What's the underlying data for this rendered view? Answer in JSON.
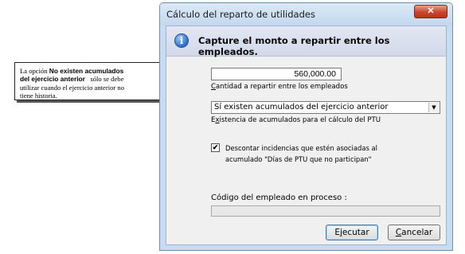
{
  "note": {
    "line1_prefix": "La opción ",
    "line1_bold": "No existen acumulados",
    "line2_bold": "del ejercicio anterior",
    "line2_suffix": "   sólo se debe",
    "line3": "utilizar cuando el ejercicio anterior no",
    "line4": "tiene historia."
  },
  "window": {
    "title": "Cálculo del reparto de utilidades",
    "close_symbol": "✕"
  },
  "header": {
    "icon": "info-icon",
    "text": "Capture el monto a repartir entre los empleados."
  },
  "amount": {
    "value": "560,000.00",
    "label_mnemonic": "C",
    "label_rest": "antidad a repartir entre los empleados"
  },
  "existence": {
    "selected": "Sí existen acumulados del ejercicio anterior",
    "label_prefix": "E",
    "label_mnemonic": "x",
    "label_rest": "istencia de acumulados para el cálculo del PTU"
  },
  "discount": {
    "checked": true,
    "check_mark": "✔",
    "line1": "Descontar incidencias que estén asociadas al",
    "line2": "acumulado \"Días de PTU que no participan\""
  },
  "process": {
    "label": "Código del empleado en proceso :"
  },
  "buttons": {
    "run_prefix": "E",
    "run_mnemonic": "j",
    "run_rest": "ecutar",
    "cancel_mnemonic": "C",
    "cancel_rest": "ancelar"
  }
}
